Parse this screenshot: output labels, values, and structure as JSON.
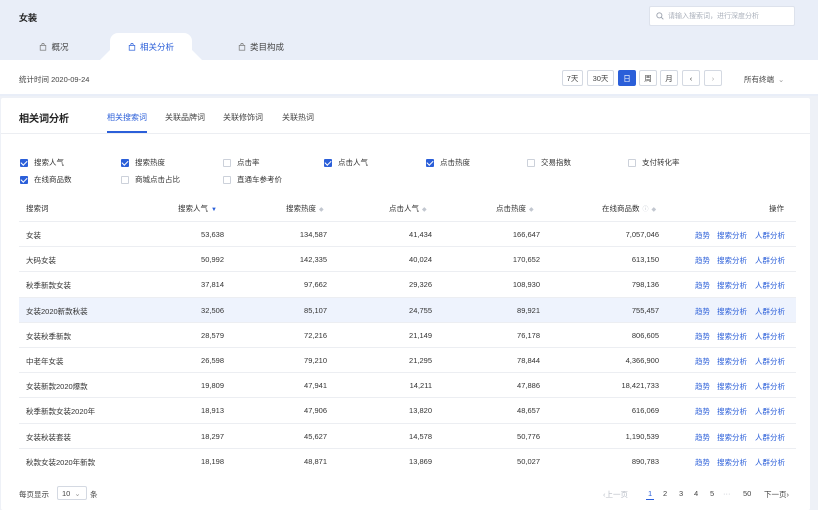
{
  "header": {
    "title": "女装",
    "search_placeholder": "请输入搜索词，进行深度分析"
  },
  "main_tabs": [
    {
      "label": "概况"
    },
    {
      "label": "相关分析"
    },
    {
      "label": "类目构成"
    }
  ],
  "toolbar": {
    "stat_time": "统计时间 2020-09-24",
    "range_buttons": [
      "7天",
      "30天",
      "日",
      "周",
      "月"
    ],
    "prev": "‹",
    "next": "›",
    "terminal": "所有终端"
  },
  "card": {
    "title": "相关词分析",
    "subtabs": [
      "相关搜索词",
      "关联品牌词",
      "关联修饰词",
      "关联热词"
    ]
  },
  "options": [
    {
      "label": "搜索人气",
      "checked": true
    },
    {
      "label": "搜索热度",
      "checked": true
    },
    {
      "label": "点击率",
      "checked": false
    },
    {
      "label": "点击人气",
      "checked": true
    },
    {
      "label": "点击热度",
      "checked": true
    },
    {
      "label": "交易指数",
      "checked": false
    },
    {
      "label": "支付转化率",
      "checked": false
    },
    {
      "label": "在线商品数",
      "checked": true
    },
    {
      "label": "商城点击占比",
      "checked": false
    },
    {
      "label": "直通车参考价",
      "checked": false
    }
  ],
  "table": {
    "columns": [
      "搜索词",
      "搜索人气",
      "搜索热度",
      "点击人气",
      "点击热度",
      "在线商品数",
      "操作"
    ],
    "actions": [
      "趋势",
      "搜索分析",
      "人群分析"
    ],
    "rows": [
      [
        "女装",
        "53,638",
        "134,587",
        "41,434",
        "166,647",
        "7,057,046"
      ],
      [
        "大码女装",
        "50,992",
        "142,335",
        "40,024",
        "170,652",
        "613,150"
      ],
      [
        "秋季新款女装",
        "37,814",
        "97,662",
        "29,326",
        "108,930",
        "798,136"
      ],
      [
        "女装2020新款秋装",
        "32,506",
        "85,107",
        "24,755",
        "89,921",
        "755,457"
      ],
      [
        "女装秋季新款",
        "28,579",
        "72,216",
        "21,149",
        "76,178",
        "806,605"
      ],
      [
        "中老年女装",
        "26,598",
        "79,210",
        "21,295",
        "78,844",
        "4,366,900"
      ],
      [
        "女装新款2020爆款",
        "19,809",
        "47,941",
        "14,211",
        "47,886",
        "18,421,733"
      ],
      [
        "秋季新款女装2020年",
        "18,913",
        "47,906",
        "13,820",
        "48,657",
        "616,069"
      ],
      [
        "女装秋装套装",
        "18,297",
        "45,627",
        "14,578",
        "50,776",
        "1,190,539"
      ],
      [
        "秋款女装2020年新款",
        "18,198",
        "48,871",
        "13,869",
        "50,027",
        "890,783"
      ]
    ]
  },
  "footer": {
    "per_page_prefix": "每页显示",
    "per_page_value": "10",
    "per_page_suffix": "条",
    "prev": "‹上一页",
    "pages": [
      "1",
      "2",
      "3",
      "4",
      "5",
      "···",
      "50"
    ],
    "next": "下一页›"
  },
  "colors": {
    "accent": "#2b5fd9",
    "highlight_row": "#eef3fd"
  }
}
